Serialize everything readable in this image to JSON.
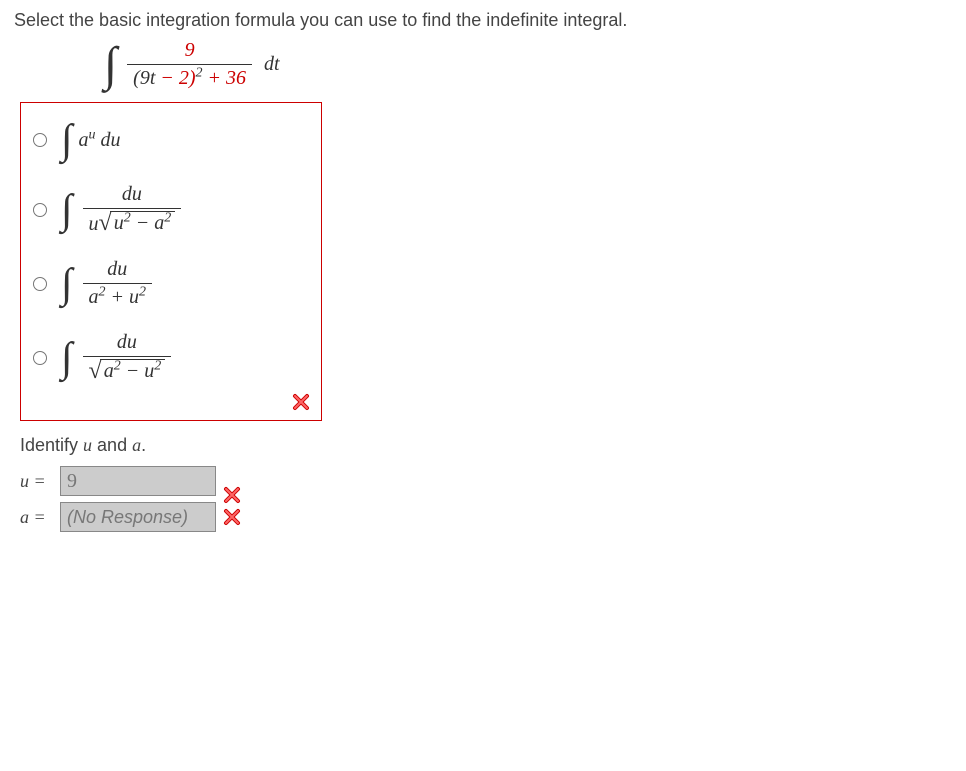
{
  "question": "Select the basic integration formula you can use to find the indefinite integral.",
  "main_integral": {
    "numerator": "9",
    "denom_base": "(9",
    "denom_t": "t",
    "denom_minus2": " − 2)",
    "denom_exp": "2",
    "denom_plus": " + 36",
    "dt": "dt"
  },
  "options": [
    {
      "id": "opt1"
    },
    {
      "id": "opt2"
    },
    {
      "id": "opt3"
    },
    {
      "id": "opt4"
    }
  ],
  "opt_text": {
    "a": "a",
    "u": "u",
    "du": "du",
    "usq": "u",
    "asq": "a",
    "two": "2",
    "minus": " − ",
    "plus": " + "
  },
  "identify_text": "Identify u and a.",
  "identify_u": "u",
  "identify_and": " and ",
  "identify_a": "a",
  "u_label": "u = ",
  "a_label": "a = ",
  "u_value": "9",
  "a_placeholder": "(No Response)"
}
